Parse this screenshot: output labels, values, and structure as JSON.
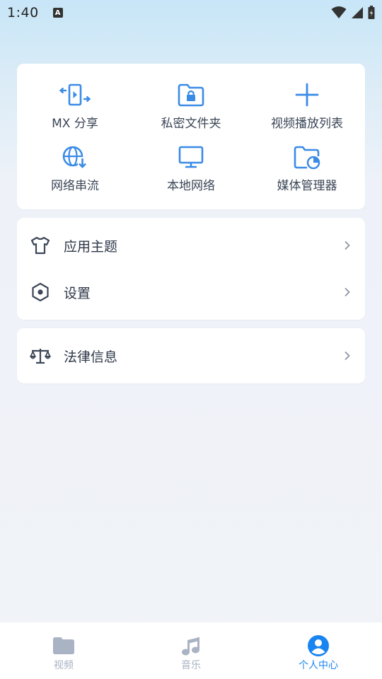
{
  "status_bar": {
    "time": "1:40",
    "notification_badge": "A"
  },
  "quick_actions": [
    {
      "label": "MX 分享",
      "icon": "share-transfer-icon"
    },
    {
      "label": "私密文件夹",
      "icon": "private-folder-icon"
    },
    {
      "label": "视频播放列表",
      "icon": "add-icon"
    },
    {
      "label": "网络串流",
      "icon": "network-stream-icon"
    },
    {
      "label": "本地网络",
      "icon": "monitor-icon"
    },
    {
      "label": "媒体管理器",
      "icon": "media-manager-icon"
    }
  ],
  "menu": {
    "theme": {
      "label": "应用主题",
      "icon": "tshirt-icon"
    },
    "settings": {
      "label": "设置",
      "icon": "hexagon-settings-icon"
    },
    "legal": {
      "label": "法律信息",
      "icon": "scales-icon"
    }
  },
  "bottom_nav": {
    "items": [
      {
        "label": "视频",
        "icon": "folder-icon",
        "active": false
      },
      {
        "label": "音乐",
        "icon": "music-note-icon",
        "active": false
      },
      {
        "label": "个人中心",
        "icon": "user-icon",
        "active": true
      }
    ]
  },
  "colors": {
    "accent": "#1a85f0",
    "icon_blue": "#3a8be6",
    "inactive": "#a7b1c2"
  }
}
